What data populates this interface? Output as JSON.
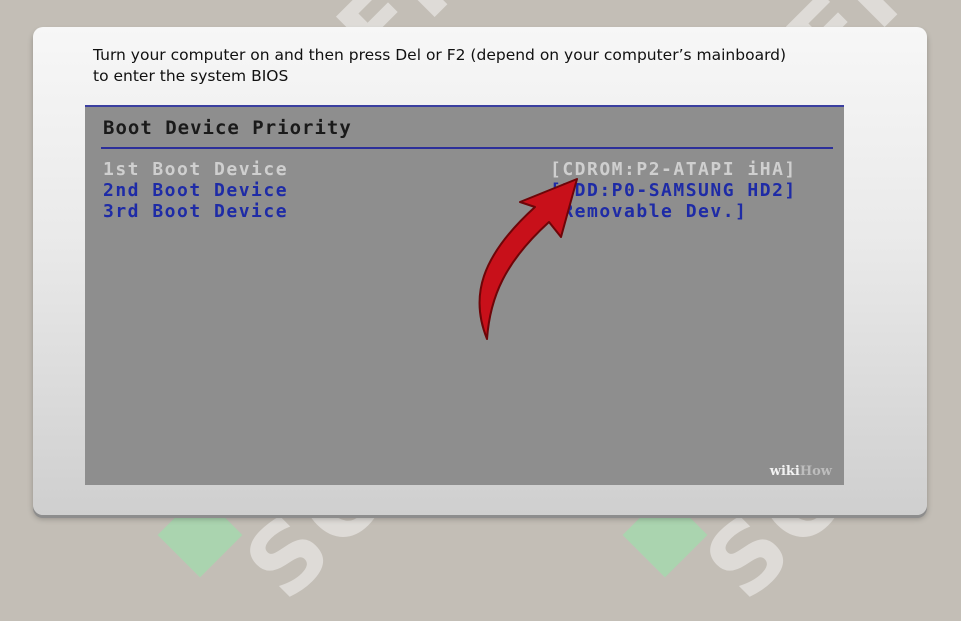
{
  "caption": {
    "line1": "Turn your computer on and then press Del or F2 (depend on your computer’s mainboard)",
    "line2": "to enter the system BIOS"
  },
  "watermark": {
    "text": "SOFF"
  },
  "bios": {
    "title": "Boot Device Priority",
    "rows": [
      {
        "label": "1st Boot Device",
        "value": "[CDROM:P2-ATAPI iHA]",
        "selected": true
      },
      {
        "label": "2nd Boot Device",
        "value": "[HDD:P0-SAMSUNG HD2]",
        "selected": false
      },
      {
        "label": "3rd Boot Device",
        "value": "[Removable Dev.]",
        "selected": false
      }
    ],
    "colors": {
      "selected": "#cfcfcf",
      "normal": "#1e2ba6",
      "background": "#8e8e8e",
      "rule": "#2c2f9a"
    }
  },
  "wikihow": {
    "part1": "wiki",
    "part2": "How"
  },
  "arrow": {
    "color": "#c8101a",
    "icon": "red-curved-arrow-icon"
  }
}
